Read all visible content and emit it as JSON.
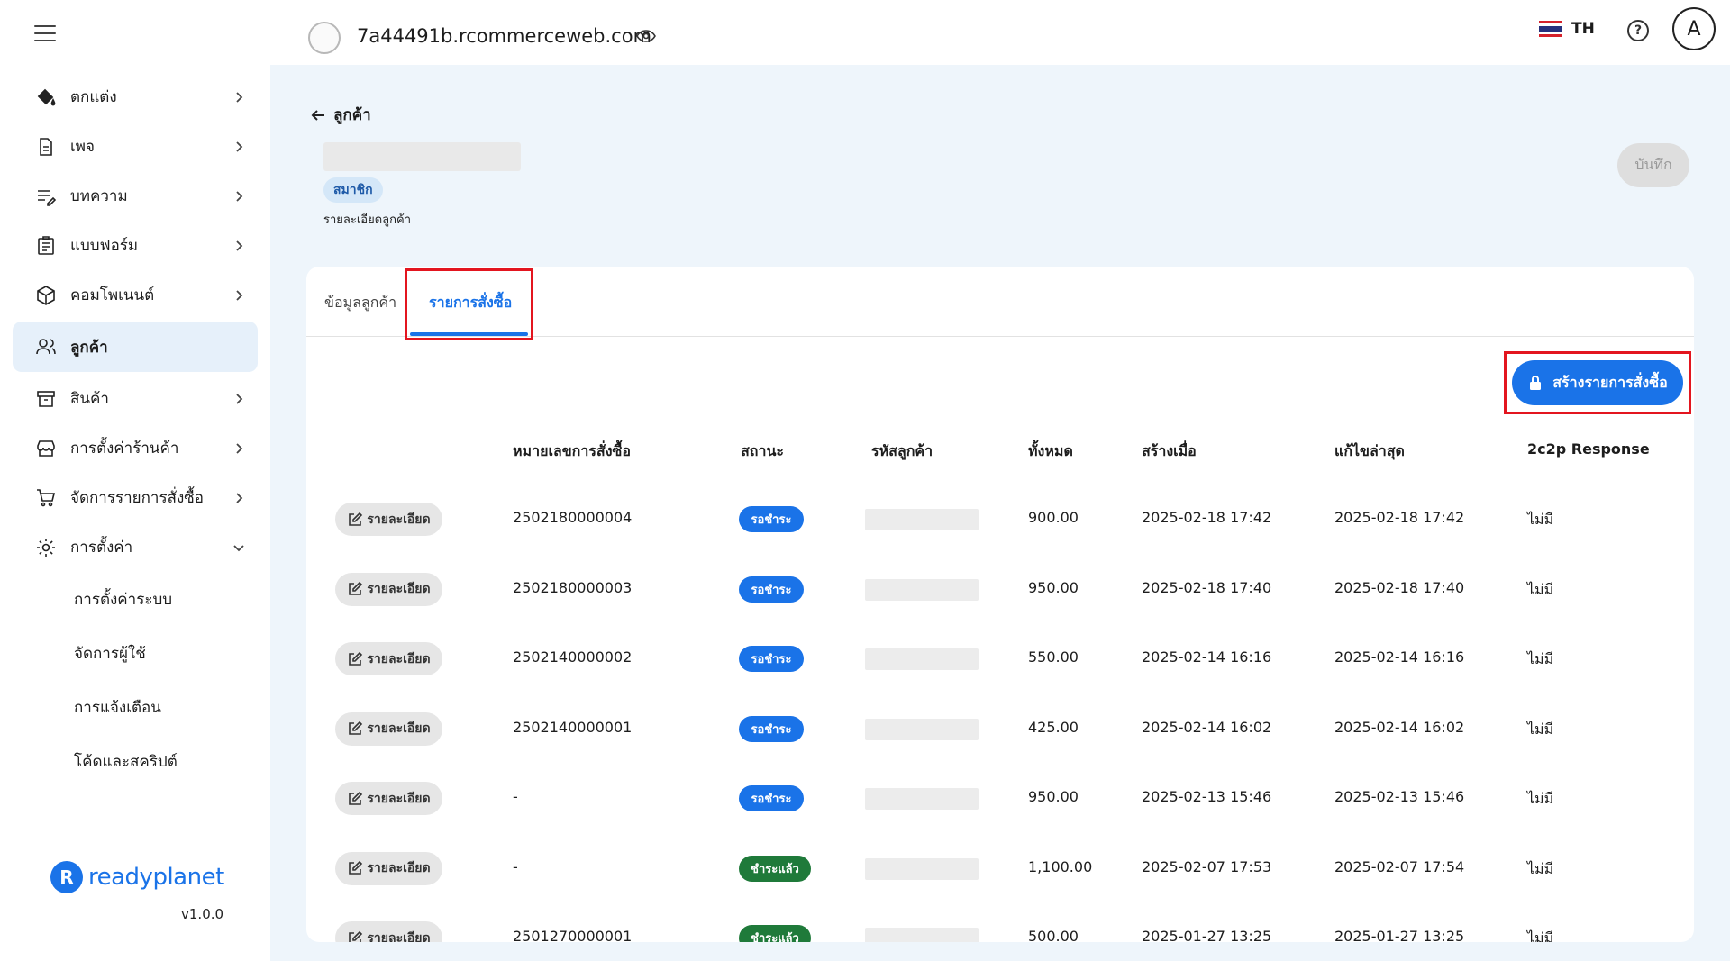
{
  "header": {
    "site_name": "7a44491b.rcommerceweb.com",
    "lang": "TH",
    "help_icon": "?",
    "user_initial": "A"
  },
  "sidebar": {
    "items": [
      {
        "label": "ตกแต่ง",
        "icon": "paint-bucket-icon"
      },
      {
        "label": "เพจ",
        "icon": "page-icon"
      },
      {
        "label": "บทความ",
        "icon": "article-icon"
      },
      {
        "label": "แบบฟอร์ม",
        "icon": "form-icon"
      },
      {
        "label": "คอมโพเนนต์",
        "icon": "component-icon"
      },
      {
        "label": "ลูกค้า",
        "icon": "customers-icon"
      },
      {
        "label": "สินค้า",
        "icon": "product-icon"
      },
      {
        "label": "การตั้งค่าร้านค้า",
        "icon": "store-settings-icon"
      },
      {
        "label": "จัดการรายการสั่งซื้อ",
        "icon": "cart-icon"
      },
      {
        "label": "การตั้งค่า",
        "icon": "gear-icon"
      }
    ],
    "sub_items": [
      {
        "label": "การตั้งค่าระบบ"
      },
      {
        "label": "จัดการผู้ใช้"
      },
      {
        "label": "การแจ้งเตือน"
      },
      {
        "label": "โค้ดและสคริปต์"
      }
    ],
    "brand_logo": "R",
    "brand": "readyplanet",
    "version": "v1.0.0"
  },
  "page": {
    "back_label": "ลูกค้า",
    "member_badge": "สมาชิก",
    "detail_caption": "รายละเอียดลูกค้า",
    "save_label": "บันทึก"
  },
  "tabs": [
    {
      "label": "ข้อมูลลูกค้า",
      "active": false
    },
    {
      "label": "รายการสั่งซื้อ",
      "active": true
    }
  ],
  "create_order_label": "สร้างรายการสั่งซื้อ",
  "table": {
    "columns": [
      "หมายเลขการสั่งซื้อ",
      "สถานะ",
      "รหัสลูกค้า",
      "ทั้งหมด",
      "สร้างเมื่อ",
      "แก้ไขล่าสุด",
      "2c2p Response"
    ],
    "detail_label": "รายละเอียด",
    "rows": [
      {
        "order_no": "2502180000004",
        "status": "รอชำระ",
        "status_type": "pending",
        "total": "900.00",
        "created": "2025-02-18 17:42",
        "updated": "2025-02-18 17:42",
        "response": "ไม่มี"
      },
      {
        "order_no": "2502180000003",
        "status": "รอชำระ",
        "status_type": "pending",
        "total": "950.00",
        "created": "2025-02-18 17:40",
        "updated": "2025-02-18 17:40",
        "response": "ไม่มี"
      },
      {
        "order_no": "2502140000002",
        "status": "รอชำระ",
        "status_type": "pending",
        "total": "550.00",
        "created": "2025-02-14 16:16",
        "updated": "2025-02-14 16:16",
        "response": "ไม่มี"
      },
      {
        "order_no": "2502140000001",
        "status": "รอชำระ",
        "status_type": "pending",
        "total": "425.00",
        "created": "2025-02-14 16:02",
        "updated": "2025-02-14 16:02",
        "response": "ไม่มี"
      },
      {
        "order_no": "-",
        "status": "รอชำระ",
        "status_type": "pending",
        "total": "950.00",
        "created": "2025-02-13 15:46",
        "updated": "2025-02-13 15:46",
        "response": "ไม่มี"
      },
      {
        "order_no": "-",
        "status": "ชำระแล้ว",
        "status_type": "paid",
        "total": "1,100.00",
        "created": "2025-02-07 17:53",
        "updated": "2025-02-07 17:54",
        "response": "ไม่มี"
      },
      {
        "order_no": "2501270000001",
        "status": "ชำระแล้ว",
        "status_type": "paid",
        "total": "500.00",
        "created": "2025-01-27 13:25",
        "updated": "2025-01-27 13:25",
        "response": "ไม่มี"
      }
    ]
  },
  "colors": {
    "accent": "#1a73e8",
    "paid": "#1f7a3a",
    "highlight": "#e3151f"
  }
}
